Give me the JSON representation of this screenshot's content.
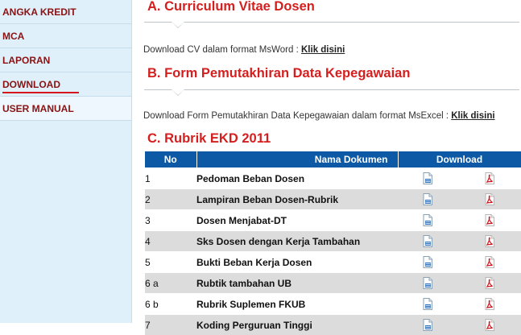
{
  "sidebar": {
    "items": [
      {
        "label": "ANGKA KREDIT"
      },
      {
        "label": "MCA"
      },
      {
        "label": "LAPORAN"
      },
      {
        "label": "DOWNLOAD"
      },
      {
        "label": "USER MANUAL"
      }
    ]
  },
  "sections": {
    "a": {
      "title": "A. Curriculum Vitae Dosen",
      "desc": "Download CV dalam format MsWord : ",
      "link": "Klik disini"
    },
    "b": {
      "title": "B. Form Pemutakhiran Data Kepegawaian",
      "desc": "Download Form Pemutakhiran Data Kepegawaian dalam format MsExcel : ",
      "link": "Klik disini"
    },
    "c": {
      "title": "C. Rubrik EKD 2011"
    }
  },
  "table": {
    "headers": {
      "no": "No",
      "name": "Nama Dokumen",
      "download": "Download"
    },
    "rows": [
      {
        "no": "1",
        "name": "Pedoman Beban Dosen"
      },
      {
        "no": "2",
        "name": "Lampiran Beban Dosen-Rubrik"
      },
      {
        "no": "3",
        "name": "Dosen Menjabat-DT"
      },
      {
        "no": "4",
        "name": "Sks Dosen dengan Kerja Tambahan"
      },
      {
        "no": "5",
        "name": "Bukti Beban Kerja Dosen"
      },
      {
        "no": "6 a",
        "name": "Rubtik tambahan UB"
      },
      {
        "no": "6 b",
        "name": "Rubrik Suplemen FKUB"
      },
      {
        "no": "7",
        "name": "Koding Perguruan Tinggi"
      }
    ]
  },
  "colors": {
    "accent_red": "#d41f1f",
    "table_header": "#0d59a5",
    "sidebar_bg": "#dff0fb"
  },
  "icons": {
    "word": "word-document-icon",
    "pdf": "pdf-icon"
  }
}
